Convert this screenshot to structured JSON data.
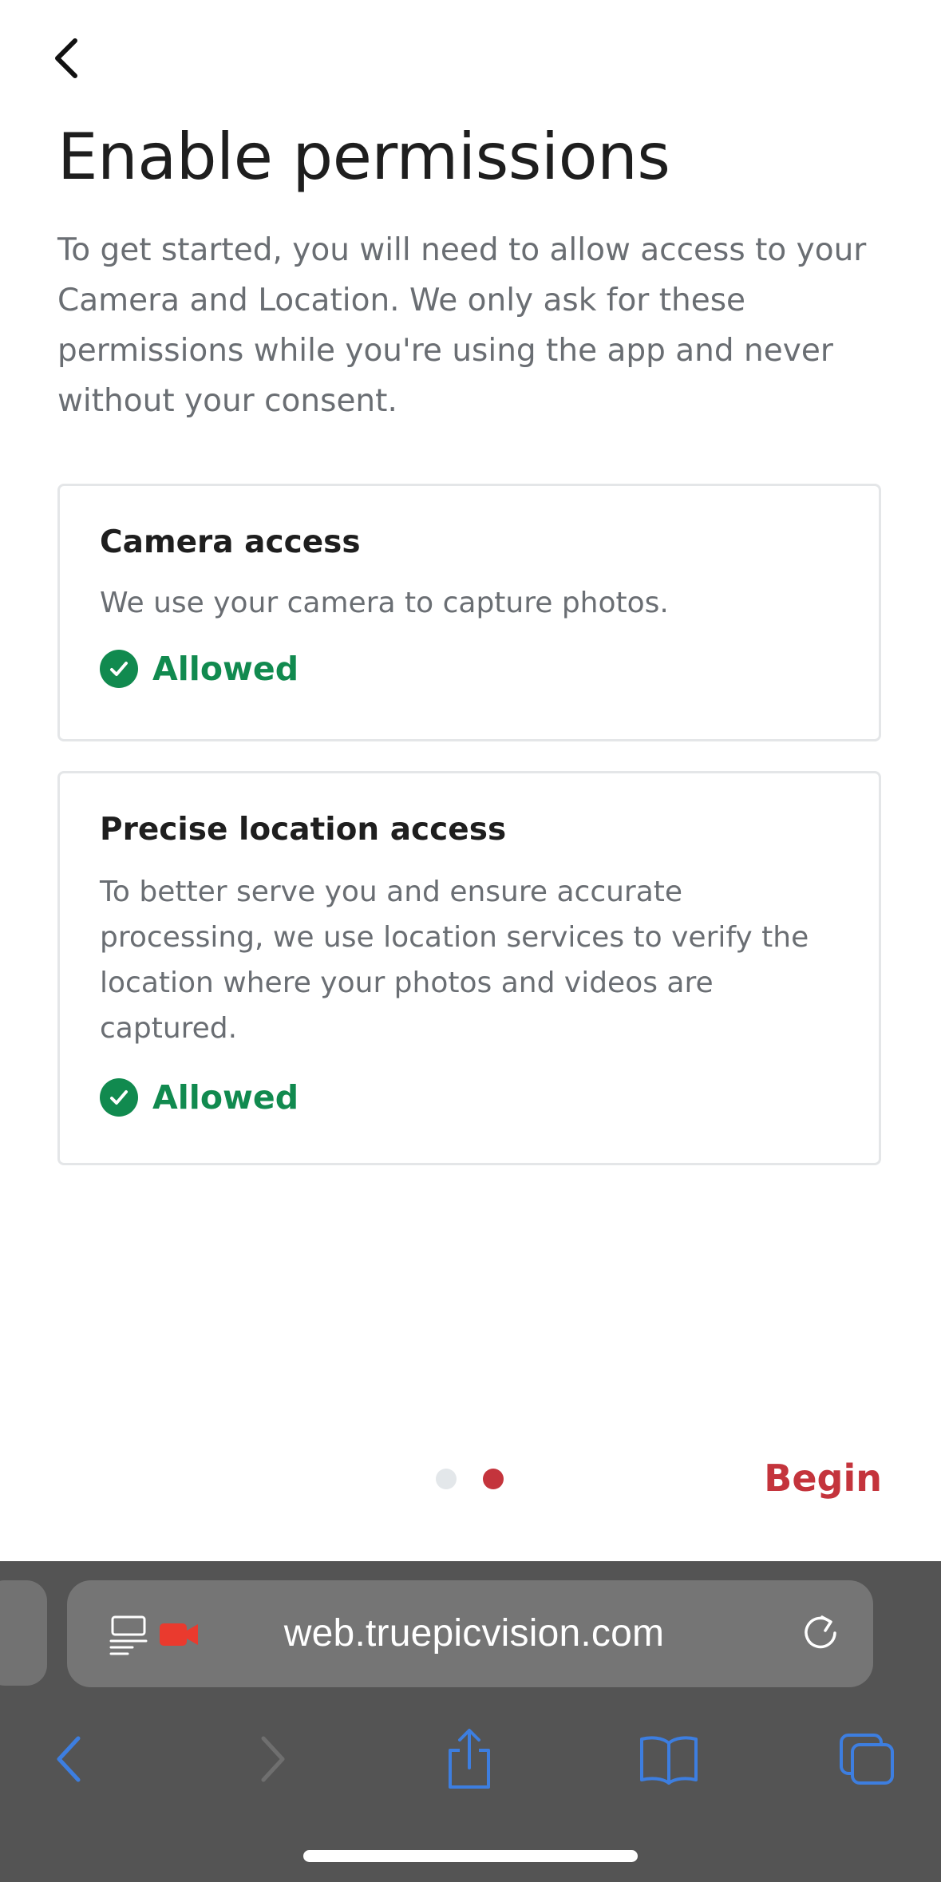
{
  "header": {
    "back_icon": "chevron-left-icon",
    "title": "Enable permissions",
    "intro": "To get started, you will need to allow access to your Camera and Location. We only ask for these permissions while you're using the app and never without your consent."
  },
  "permissions": [
    {
      "title": "Camera access",
      "description": "We use your camera to capture photos.",
      "status": "Allowed",
      "status_icon": "check-circle-icon"
    },
    {
      "title": "Precise location access",
      "description": "To better serve you and ensure accurate processing, we use location services to verify the location where your photos and videos are captured.",
      "status": "Allowed",
      "status_icon": "check-circle-icon"
    }
  ],
  "pager": {
    "total": 2,
    "current": 2
  },
  "footer": {
    "begin_label": "Begin"
  },
  "browser": {
    "url": "web.truepicvision.com",
    "icons": {
      "page_menu": "page-menu-icon",
      "recording": "camera-recording-icon",
      "reload": "reload-icon",
      "back": "back-arrow-icon",
      "forward": "forward-arrow-icon",
      "share": "share-icon",
      "bookmarks": "bookmarks-icon",
      "tabs": "tabs-icon"
    }
  },
  "colors": {
    "accent": "#c4343c",
    "success": "#118a4f",
    "browser_blue": "#3d7ee0",
    "text_muted": "#6a6e73"
  }
}
